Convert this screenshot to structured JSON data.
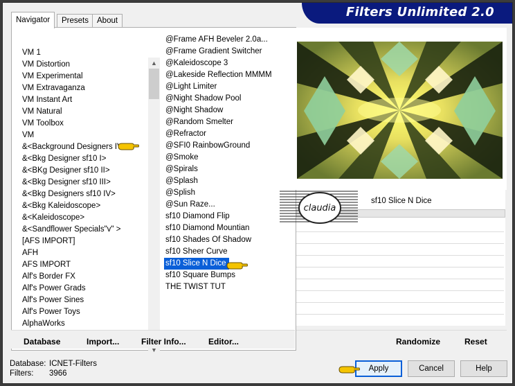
{
  "window": {
    "title": "Filters Unlimited 2.0"
  },
  "tabs": [
    {
      "label": "Navigator",
      "active": true
    },
    {
      "label": "Presets",
      "active": false
    },
    {
      "label": "About",
      "active": false
    }
  ],
  "categories": [
    "VM 1",
    "VM Distortion",
    "VM Experimental",
    "VM Extravaganza",
    "VM Instant Art",
    "VM Natural",
    "VM Toolbox",
    "VM",
    "&<Background Designers IV>",
    "&<Bkg Designer sf10 I>",
    "&<BKg Designer sf10 II>",
    "&<Bkg Designer sf10 III>",
    "&<Bkg Designers sf10 IV>",
    "&<Bkg Kaleidoscope>",
    "&<Kaleidoscope>",
    "&<Sandflower Specials\"v\" >",
    "[AFS IMPORT]",
    "AFH",
    "AFS IMPORT",
    "Alf's Border FX",
    "Alf's Power Grads",
    "Alf's Power Sines",
    "Alf's Power Toys",
    "AlphaWorks"
  ],
  "filters": [
    "@Frame AFH Beveler 2.0a...",
    "@Frame Gradient Switcher",
    "@Kaleidoscope 3",
    "@Lakeside Reflection MMMM",
    "@Light Limiter",
    "@Night Shadow Pool",
    "@Night Shadow",
    "@Random Smelter",
    "@Refractor",
    "@SFI0 RainbowGround",
    "@Smoke",
    "@Spirals",
    "@Splash",
    "@Splish",
    "@Sun Raze...",
    "sf10 Diamond Flip",
    "sf10 Diamond Mountian",
    "sf10 Shades Of Shadow",
    "sf10 Sheer Curve",
    "sf10 Slice N Dice",
    "sf10 Square Bumps",
    "THE TWIST TUT"
  ],
  "selected_filter": "sf10 Slice N Dice",
  "selected_filter_index": 19,
  "pointed_category_index": 8,
  "filter_label": "sf10 Slice N Dice",
  "watermark": "claudia",
  "toolbar": {
    "database": "Database",
    "import": "Import...",
    "filter_info": "Filter Info...",
    "editor": "Editor...",
    "randomize": "Randomize",
    "reset": "Reset"
  },
  "info": {
    "database_label": "Database:",
    "database_value": "ICNET-Filters",
    "filters_label": "Filters:",
    "filters_value": "3966"
  },
  "buttons": {
    "apply": "Apply",
    "cancel": "Cancel",
    "help": "Help"
  },
  "colors": {
    "banner": "#0a1a7e",
    "selection": "#0a5fd8",
    "hand": "#f5c400"
  }
}
